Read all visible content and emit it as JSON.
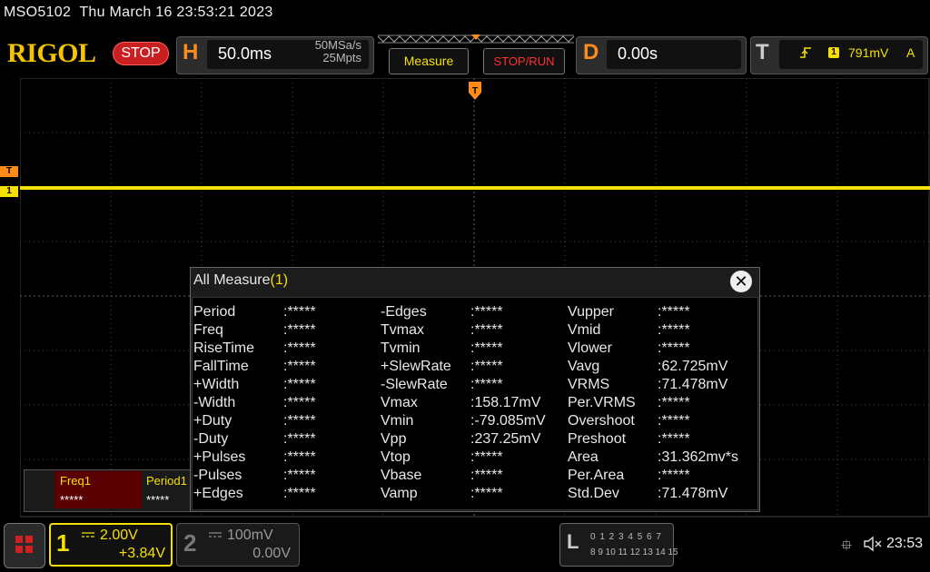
{
  "status": {
    "model": "MSO5102",
    "datetime": "Thu March 16 23:53:21 2023"
  },
  "header": {
    "logo": "RIGOL",
    "run_state": "STOP",
    "horizontal": {
      "letter": "H",
      "timebase": "50.0ms",
      "sample_rate": "50MSa/s",
      "memory_depth": "25Mpts"
    },
    "measure_label": "Measure",
    "stop_run_label": "STOP/RUN",
    "delay": {
      "letter": "D",
      "value": "0.00s"
    },
    "trigger": {
      "letter": "T",
      "slope_icon": "rising-edge-icon",
      "source": "1",
      "level": "791mV",
      "mode": "A"
    }
  },
  "markers": {
    "trigger_marker": "T",
    "ch1_marker": "1",
    "top_marker": "T"
  },
  "colors": {
    "ch1": "#f5e000",
    "trigger": "#ff8c1a",
    "stop": "#c82020",
    "grid": "#4a4a4a"
  },
  "measure_dialog": {
    "title": "All Measure",
    "channel": "(1)",
    "close_icon": "close-icon",
    "columns": [
      [
        {
          "name": "Period",
          "value": ":*****"
        },
        {
          "name": "Freq",
          "value": ":*****"
        },
        {
          "name": "RiseTime",
          "value": ":*****"
        },
        {
          "name": "FallTime",
          "value": ":*****"
        },
        {
          "name": "+Width",
          "value": ":*****"
        },
        {
          "name": "-Width",
          "value": ":*****"
        },
        {
          "name": "+Duty",
          "value": ":*****"
        },
        {
          "name": "-Duty",
          "value": ":*****"
        },
        {
          "name": "+Pulses",
          "value": ":*****"
        },
        {
          "name": "-Pulses",
          "value": ":*****"
        },
        {
          "name": "+Edges",
          "value": ":*****"
        }
      ],
      [
        {
          "name": "-Edges",
          "value": ":*****"
        },
        {
          "name": "Tvmax",
          "value": ":*****"
        },
        {
          "name": "Tvmin",
          "value": ":*****"
        },
        {
          "name": "+SlewRate",
          "value": ":*****"
        },
        {
          "name": "-SlewRate",
          "value": ":*****"
        },
        {
          "name": "Vmax",
          "value": ":158.17mV"
        },
        {
          "name": "Vmin",
          "value": ":-79.085mV"
        },
        {
          "name": "Vpp",
          "value": ":237.25mV"
        },
        {
          "name": "Vtop",
          "value": ":*****"
        },
        {
          "name": "Vbase",
          "value": ":*****"
        },
        {
          "name": "Vamp",
          "value": ":*****"
        }
      ],
      [
        {
          "name": "Vupper",
          "value": ":*****"
        },
        {
          "name": "Vmid",
          "value": ":*****"
        },
        {
          "name": "Vlower",
          "value": ":*****"
        },
        {
          "name": "Vavg",
          "value": ":62.725mV"
        },
        {
          "name": "VRMS",
          "value": ":71.478mV"
        },
        {
          "name": "Per.VRMS",
          "value": ":*****"
        },
        {
          "name": "Overshoot",
          "value": ":*****"
        },
        {
          "name": "Preshoot",
          "value": ":*****"
        },
        {
          "name": "Area",
          "value": ":31.362mv*s"
        },
        {
          "name": "Per.Area",
          "value": ":*****"
        },
        {
          "name": "Std.Dev",
          "value": ":71.478mV"
        }
      ]
    ]
  },
  "stats": {
    "freq_label": "Freq1",
    "freq_value": "*****",
    "period_label": "Period1",
    "period_value": "*****"
  },
  "channels": [
    {
      "number": "1",
      "scale": "2.00V",
      "offset": "+3.84V",
      "coupling_icon": "dc-coupling-icon"
    },
    {
      "number": "2",
      "scale": "100mV",
      "offset": "0.00V",
      "coupling_icon": "dc-coupling-icon"
    }
  ],
  "logic": {
    "letter": "L",
    "row1": "0 1 2 3  4 5 6 7",
    "row2": "8 9 10 11 12 13 14 15"
  },
  "system": {
    "usb_icon": "usb-icon",
    "sound_icon": "mute-speaker-icon",
    "time": "23:53"
  }
}
